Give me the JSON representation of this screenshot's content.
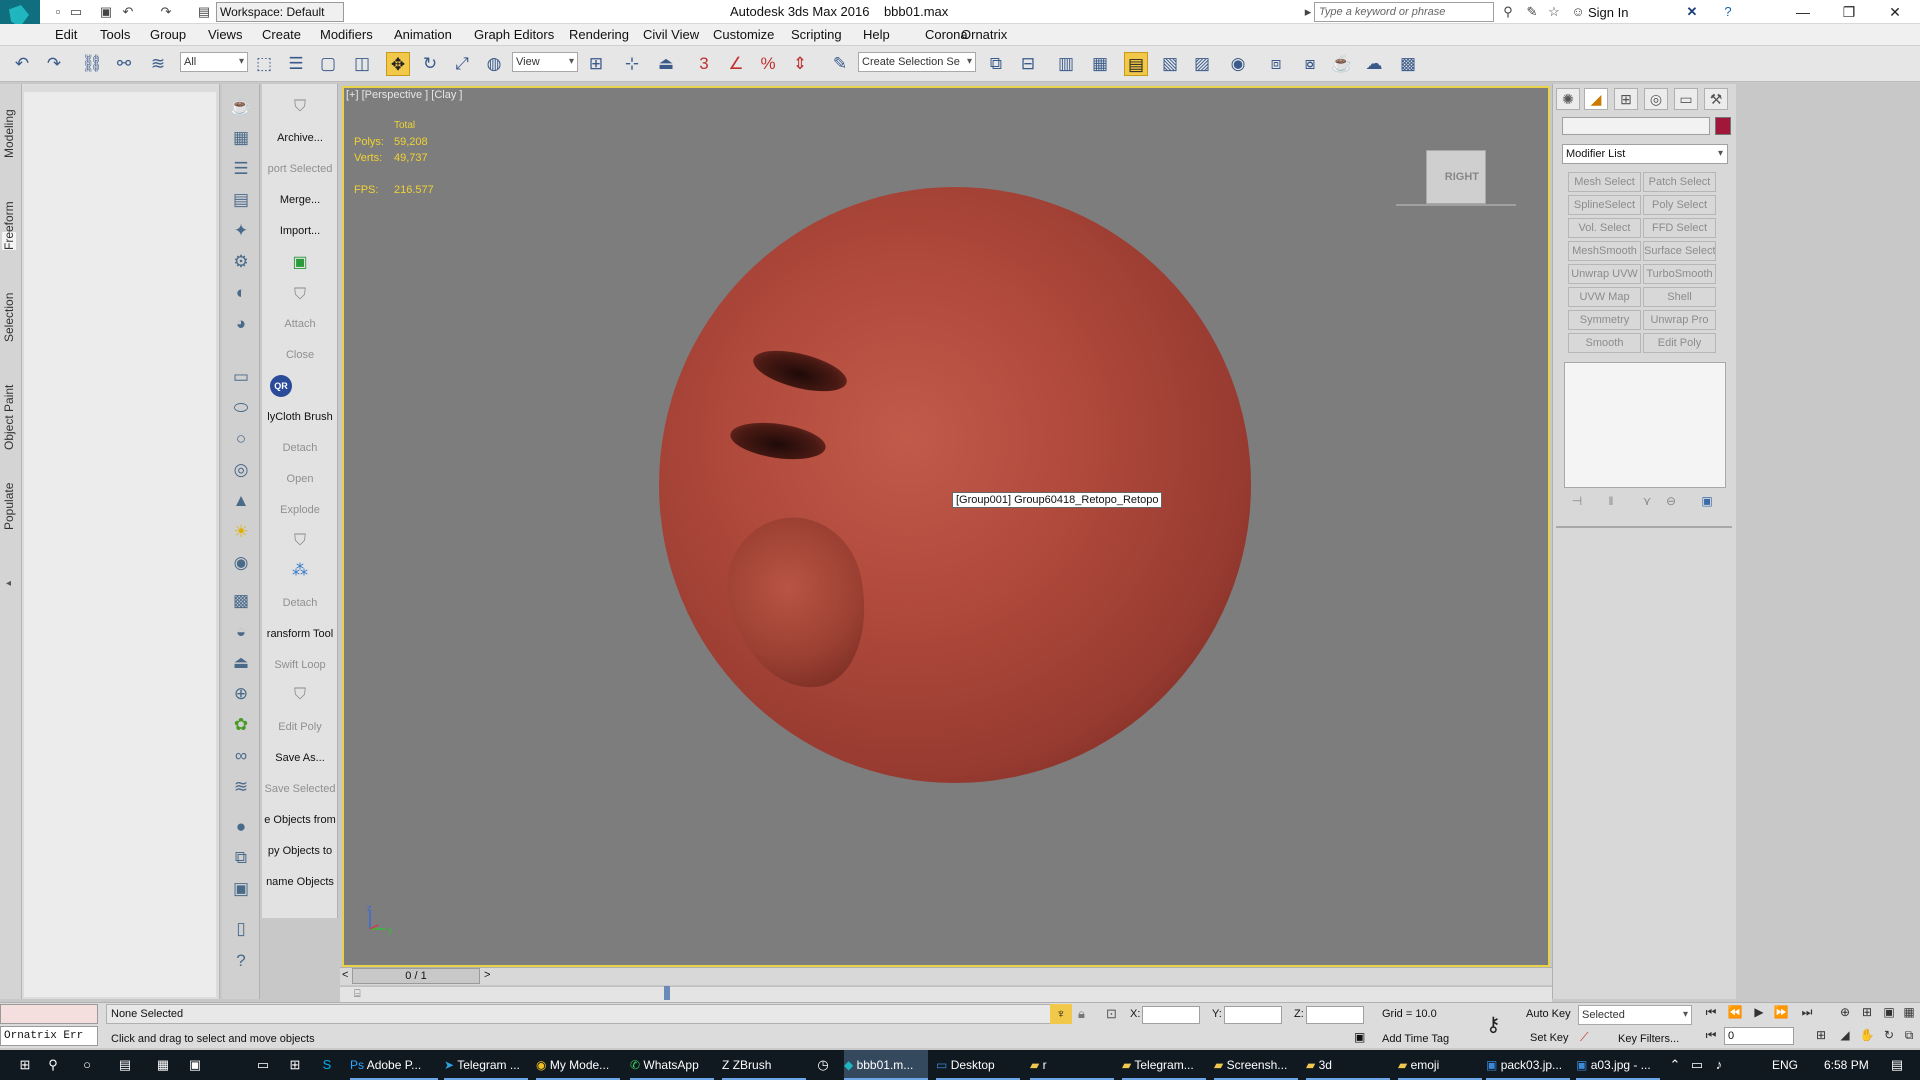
{
  "app": {
    "logo_text": "MAX",
    "workspace_label": "Workspace: Default",
    "window_title": "Autodesk 3ds Max 2016",
    "file_name": "bbb01.max",
    "search_placeholder": "Type a keyword or phrase",
    "sign_in": "Sign In"
  },
  "menu": [
    "Edit",
    "Tools",
    "Group",
    "Views",
    "Create",
    "Modifiers",
    "Animation",
    "Graph Editors",
    "Rendering",
    "Civil View",
    "Customize",
    "Scripting",
    "Help",
    "Corona",
    "Ornatrix"
  ],
  "toolbar": {
    "selection_filter": "All",
    "ref_coord": "View",
    "named_selection": "Create Selection Se",
    "snap_label": "3"
  },
  "ribbon_tabs": [
    "Modeling",
    "Freeform",
    "Selection",
    "Object Paint",
    "Populate"
  ],
  "commands": [
    {
      "label": "Archive...",
      "enabled": true
    },
    {
      "label": "port Selected",
      "enabled": false
    },
    {
      "label": "Merge...",
      "enabled": true
    },
    {
      "label": "Import...",
      "enabled": true
    },
    {
      "label": "Attach",
      "enabled": false
    },
    {
      "label": "Close",
      "enabled": false
    },
    {
      "label": "QR",
      "enabled": true
    },
    {
      "label": "lyCloth Brush",
      "enabled": true
    },
    {
      "label": "Detach",
      "enabled": false
    },
    {
      "label": "Open",
      "enabled": false
    },
    {
      "label": "Explode",
      "enabled": false
    },
    {
      "label": "Detach",
      "enabled": false
    },
    {
      "label": "ransform Tool",
      "enabled": true
    },
    {
      "label": "Swift Loop",
      "enabled": false
    },
    {
      "label": "Edit Poly",
      "enabled": false
    },
    {
      "label": "Save As...",
      "enabled": true
    },
    {
      "label": "Save Selected",
      "enabled": false
    },
    {
      "label": "e Objects from",
      "enabled": true
    },
    {
      "label": "py Objects to",
      "enabled": true
    },
    {
      "label": "name Objects",
      "enabled": true
    }
  ],
  "viewport": {
    "label": "[+] [Perspective ] [Clay ]",
    "stats": {
      "total_label": "Total",
      "polys_label": "Polys:",
      "polys_value": "59,208",
      "verts_label": "Verts:",
      "verts_value": "49,737",
      "fps_label": "FPS:",
      "fps_value": "216.577"
    },
    "tooltip": "[Group001] Group60418_Retopo_Retopo",
    "viewcube_label": "RIGHT",
    "axis_labels": {
      "z": "z",
      "y": "y",
      "x": "x"
    }
  },
  "timeline": {
    "frame_counter": "0 / 1",
    "prev": "<",
    "next": ">"
  },
  "command_panel": {
    "modifier_list_label": "Modifier List",
    "object_color": "#a0173a",
    "modifier_buttons": [
      "Mesh Select",
      "Patch Select",
      "SplineSelect",
      "Poly Select",
      "Vol. Select",
      "FFD Select",
      "MeshSmooth",
      "Surface Select",
      "Unwrap UVW",
      "TurboSmooth",
      "UVW Map",
      "Shell",
      "Symmetry",
      "Unwrap Pro",
      "Smooth",
      "Edit Poly"
    ]
  },
  "status_bar": {
    "script_line": "Ornatrix Err",
    "selection_status": "None Selected",
    "prompt": "Click and drag to select and move objects",
    "x_label": "X:",
    "y_label": "Y:",
    "z_label": "Z:",
    "grid": "Grid = 10.0",
    "add_time_tag": "Add Time Tag",
    "auto_key": "Auto Key",
    "set_key": "Set Key",
    "key_mode": "Selected",
    "key_filters": "Key Filters...",
    "current_frame": "0"
  },
  "taskbar": {
    "items": [
      "Adobe P...",
      "Telegram ...",
      "My Mode...",
      "WhatsApp",
      "ZBrush",
      "bbb01.m...",
      "Desktop",
      "r",
      "Telegram...",
      "Screensh...",
      "3d",
      "emoji",
      "pack03.jp...",
      "a03.jpg - ..."
    ],
    "language": "ENG",
    "time": "6:58 PM"
  },
  "colors": {
    "viewport_bg": "#7d7d7d",
    "active_border": "#e8d24a",
    "stats_text": "#f0d232",
    "model_red": "#b04a3c"
  }
}
